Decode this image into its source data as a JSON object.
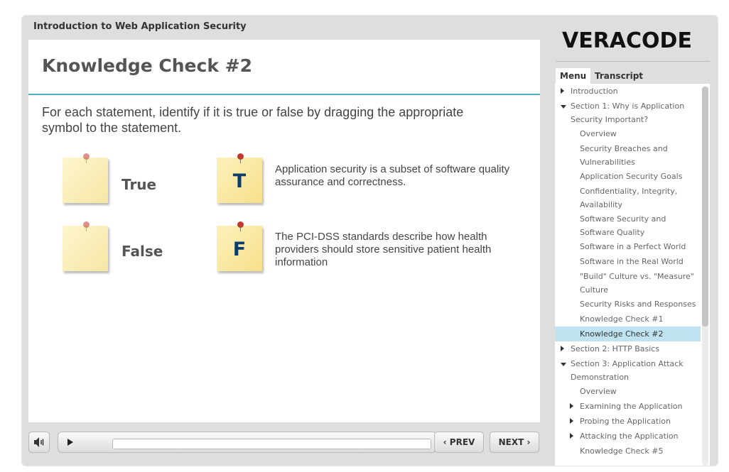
{
  "course": {
    "title": "Introduction to Web Application Security"
  },
  "slide": {
    "title": "Knowledge Check #2",
    "instructions": "For each statement, identify if it is true or false by dragging the appropriate symbol to the statement.",
    "drop_targets": [
      {
        "label": "True"
      },
      {
        "label": "False"
      }
    ],
    "statements": [
      {
        "symbol": "T",
        "text": "Application security is a subset of software quality assurance and correctness."
      },
      {
        "symbol": "F",
        "text": "The PCI-DSS standards describe how health providers should store sensitive patient health information"
      }
    ]
  },
  "controls": {
    "prev_label": "PREV",
    "next_label": "NEXT",
    "icons": {
      "volume": "volume-icon",
      "play": "play-icon",
      "replay": "replay-icon"
    }
  },
  "sidebar": {
    "logo_text": "VERACODE",
    "tabs": [
      "Menu",
      "Transcript"
    ],
    "active_tab": "Menu",
    "menu": [
      {
        "label": "Introduction",
        "level": 0,
        "caret": "right"
      },
      {
        "label": "Section 1: Why is Application Security Important?",
        "level": 0,
        "caret": "down"
      },
      {
        "label": "Overview",
        "level": 1
      },
      {
        "label": "Security Breaches and Vulnerabilities",
        "level": 1
      },
      {
        "label": "Application Security Goals",
        "level": 1
      },
      {
        "label": "Confidentiality, Integrity, Availability",
        "level": 1
      },
      {
        "label": "Software Security and Software Quality",
        "level": 1
      },
      {
        "label": "Software in a Perfect World",
        "level": 1
      },
      {
        "label": "Software in the Real World",
        "level": 1
      },
      {
        "label": "\"Build\" Culture vs. \"Measure\" Culture",
        "level": 1
      },
      {
        "label": "Security Risks and Responses",
        "level": 1
      },
      {
        "label": "Knowledge Check #1",
        "level": 1
      },
      {
        "label": "Knowledge Check #2",
        "level": 1,
        "active": true
      },
      {
        "label": "Section 2: HTTP Basics",
        "level": 0,
        "caret": "right"
      },
      {
        "label": "Section 3: Application Attack Demonstration",
        "level": 0,
        "caret": "down"
      },
      {
        "label": "Overview",
        "level": 1
      },
      {
        "label": "Examining the Application",
        "level": 1,
        "caret": "right"
      },
      {
        "label": "Probing the Application",
        "level": 1,
        "caret": "right"
      },
      {
        "label": "Attacking the Application",
        "level": 1,
        "caret": "right"
      },
      {
        "label": "Knowledge Check #5",
        "level": 1
      }
    ]
  },
  "colors": {
    "accent": "#4aaed0",
    "active_item": "#bfe3f1",
    "note": "#f7e08b",
    "letter": "#0d3c6a"
  }
}
